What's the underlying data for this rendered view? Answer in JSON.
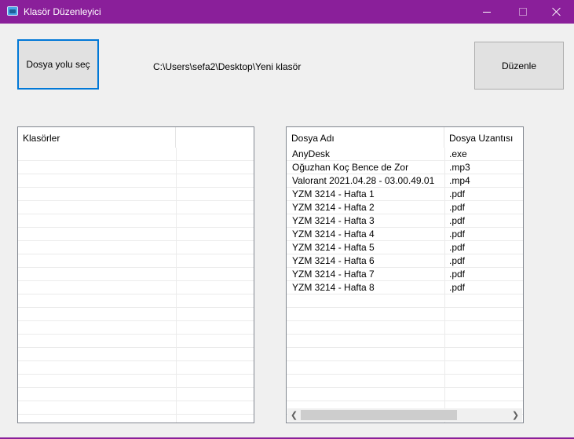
{
  "window": {
    "title": "Klasör Düzenleyici",
    "accent_color": "#8a1f9a",
    "icons": {
      "app": "folder-app-icon",
      "minimize": "minimize-icon",
      "maximize": "maximize-icon",
      "close": "close-icon"
    }
  },
  "toolbar": {
    "select_path_label": "Dosya yolu seç",
    "path_value": "C:\\Users\\sefa2\\Desktop\\Yeni klasör",
    "edit_label": "Düzenle"
  },
  "folders_list": {
    "columns": [
      "Klasörler",
      ""
    ],
    "items": []
  },
  "files_list": {
    "columns": [
      "Dosya Adı",
      "Dosya Uzantısı"
    ],
    "items": [
      {
        "name": "AnyDesk",
        "ext": ".exe"
      },
      {
        "name": "Oğuzhan Koç Bence de Zor",
        "ext": ".mp3"
      },
      {
        "name": "Valorant 2021.04.28 - 03.00.49.01",
        "ext": ".mp4"
      },
      {
        "name": "YZM 3214 - Hafta 1",
        "ext": ".pdf"
      },
      {
        "name": "YZM 3214 - Hafta 2",
        "ext": ".pdf"
      },
      {
        "name": "YZM 3214 - Hafta 3",
        "ext": ".pdf"
      },
      {
        "name": "YZM 3214 - Hafta 4",
        "ext": ".pdf"
      },
      {
        "name": "YZM 3214 - Hafta 5",
        "ext": ".pdf"
      },
      {
        "name": "YZM 3214 - Hafta 6",
        "ext": ".pdf"
      },
      {
        "name": "YZM 3214 - Hafta 7",
        "ext": ".pdf"
      },
      {
        "name": "YZM 3214 - Hafta 8",
        "ext": ".pdf"
      }
    ]
  }
}
